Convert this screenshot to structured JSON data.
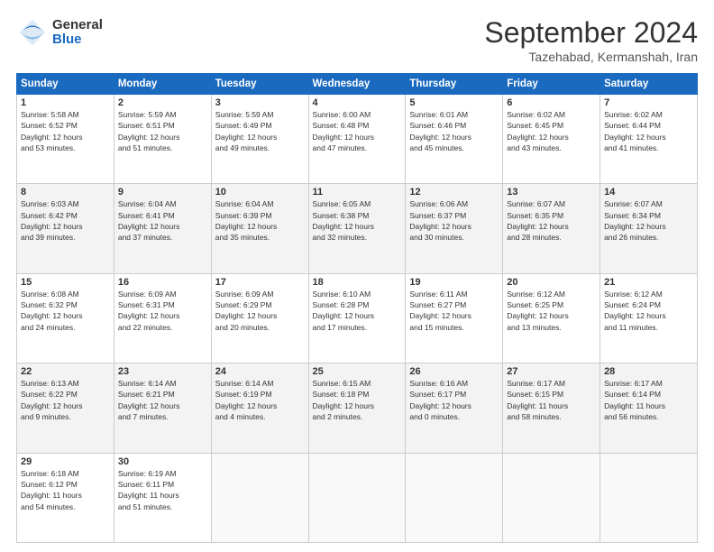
{
  "logo": {
    "general": "General",
    "blue": "Blue"
  },
  "title": "September 2024",
  "location": "Tazehabad, Kermanshah, Iran",
  "days_header": [
    "Sunday",
    "Monday",
    "Tuesday",
    "Wednesday",
    "Thursday",
    "Friday",
    "Saturday"
  ],
  "weeks": [
    [
      {
        "day": "1",
        "info": "Sunrise: 5:58 AM\nSunset: 6:52 PM\nDaylight: 12 hours\nand 53 minutes."
      },
      {
        "day": "2",
        "info": "Sunrise: 5:59 AM\nSunset: 6:51 PM\nDaylight: 12 hours\nand 51 minutes."
      },
      {
        "day": "3",
        "info": "Sunrise: 5:59 AM\nSunset: 6:49 PM\nDaylight: 12 hours\nand 49 minutes."
      },
      {
        "day": "4",
        "info": "Sunrise: 6:00 AM\nSunset: 6:48 PM\nDaylight: 12 hours\nand 47 minutes."
      },
      {
        "day": "5",
        "info": "Sunrise: 6:01 AM\nSunset: 6:46 PM\nDaylight: 12 hours\nand 45 minutes."
      },
      {
        "day": "6",
        "info": "Sunrise: 6:02 AM\nSunset: 6:45 PM\nDaylight: 12 hours\nand 43 minutes."
      },
      {
        "day": "7",
        "info": "Sunrise: 6:02 AM\nSunset: 6:44 PM\nDaylight: 12 hours\nand 41 minutes."
      }
    ],
    [
      {
        "day": "8",
        "info": "Sunrise: 6:03 AM\nSunset: 6:42 PM\nDaylight: 12 hours\nand 39 minutes."
      },
      {
        "day": "9",
        "info": "Sunrise: 6:04 AM\nSunset: 6:41 PM\nDaylight: 12 hours\nand 37 minutes."
      },
      {
        "day": "10",
        "info": "Sunrise: 6:04 AM\nSunset: 6:39 PM\nDaylight: 12 hours\nand 35 minutes."
      },
      {
        "day": "11",
        "info": "Sunrise: 6:05 AM\nSunset: 6:38 PM\nDaylight: 12 hours\nand 32 minutes."
      },
      {
        "day": "12",
        "info": "Sunrise: 6:06 AM\nSunset: 6:37 PM\nDaylight: 12 hours\nand 30 minutes."
      },
      {
        "day": "13",
        "info": "Sunrise: 6:07 AM\nSunset: 6:35 PM\nDaylight: 12 hours\nand 28 minutes."
      },
      {
        "day": "14",
        "info": "Sunrise: 6:07 AM\nSunset: 6:34 PM\nDaylight: 12 hours\nand 26 minutes."
      }
    ],
    [
      {
        "day": "15",
        "info": "Sunrise: 6:08 AM\nSunset: 6:32 PM\nDaylight: 12 hours\nand 24 minutes."
      },
      {
        "day": "16",
        "info": "Sunrise: 6:09 AM\nSunset: 6:31 PM\nDaylight: 12 hours\nand 22 minutes."
      },
      {
        "day": "17",
        "info": "Sunrise: 6:09 AM\nSunset: 6:29 PM\nDaylight: 12 hours\nand 20 minutes."
      },
      {
        "day": "18",
        "info": "Sunrise: 6:10 AM\nSunset: 6:28 PM\nDaylight: 12 hours\nand 17 minutes."
      },
      {
        "day": "19",
        "info": "Sunrise: 6:11 AM\nSunset: 6:27 PM\nDaylight: 12 hours\nand 15 minutes."
      },
      {
        "day": "20",
        "info": "Sunrise: 6:12 AM\nSunset: 6:25 PM\nDaylight: 12 hours\nand 13 minutes."
      },
      {
        "day": "21",
        "info": "Sunrise: 6:12 AM\nSunset: 6:24 PM\nDaylight: 12 hours\nand 11 minutes."
      }
    ],
    [
      {
        "day": "22",
        "info": "Sunrise: 6:13 AM\nSunset: 6:22 PM\nDaylight: 12 hours\nand 9 minutes."
      },
      {
        "day": "23",
        "info": "Sunrise: 6:14 AM\nSunset: 6:21 PM\nDaylight: 12 hours\nand 7 minutes."
      },
      {
        "day": "24",
        "info": "Sunrise: 6:14 AM\nSunset: 6:19 PM\nDaylight: 12 hours\nand 4 minutes."
      },
      {
        "day": "25",
        "info": "Sunrise: 6:15 AM\nSunset: 6:18 PM\nDaylight: 12 hours\nand 2 minutes."
      },
      {
        "day": "26",
        "info": "Sunrise: 6:16 AM\nSunset: 6:17 PM\nDaylight: 12 hours\nand 0 minutes."
      },
      {
        "day": "27",
        "info": "Sunrise: 6:17 AM\nSunset: 6:15 PM\nDaylight: 11 hours\nand 58 minutes."
      },
      {
        "day": "28",
        "info": "Sunrise: 6:17 AM\nSunset: 6:14 PM\nDaylight: 11 hours\nand 56 minutes."
      }
    ],
    [
      {
        "day": "29",
        "info": "Sunrise: 6:18 AM\nSunset: 6:12 PM\nDaylight: 11 hours\nand 54 minutes."
      },
      {
        "day": "30",
        "info": "Sunrise: 6:19 AM\nSunset: 6:11 PM\nDaylight: 11 hours\nand 51 minutes."
      },
      {
        "day": "",
        "info": ""
      },
      {
        "day": "",
        "info": ""
      },
      {
        "day": "",
        "info": ""
      },
      {
        "day": "",
        "info": ""
      },
      {
        "day": "",
        "info": ""
      }
    ]
  ]
}
